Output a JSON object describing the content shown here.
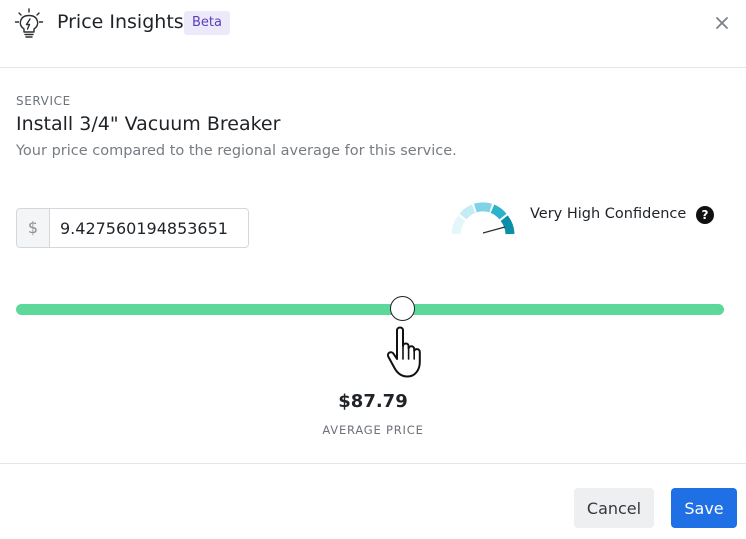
{
  "header": {
    "title": "Price Insights",
    "badge": "Beta"
  },
  "service": {
    "section_label": "SERVICE",
    "name": "Install 3/4\" Vacuum Breaker",
    "description": "Your price compared to the regional average for this service."
  },
  "price": {
    "currency_symbol": "$",
    "value": "9.427560194853651"
  },
  "confidence": {
    "label": "Very High Confidence",
    "help_glyph": "?",
    "colors": [
      "#e3f6fa",
      "#c5ecf4",
      "#7fd3e6",
      "#2cb2cd",
      "#0b8fa8"
    ]
  },
  "slider": {
    "track_color": "#5dd79a"
  },
  "average": {
    "value": "$87.79",
    "label": "AVERAGE PRICE"
  },
  "footer": {
    "cancel_label": "Cancel",
    "save_label": "Save",
    "save_color": "#1f6fe5"
  },
  "icons": {
    "header": "lightbulb-icon",
    "close": "close-icon",
    "help": "question-circle-icon",
    "pointer": "hand-pointer-icon"
  }
}
